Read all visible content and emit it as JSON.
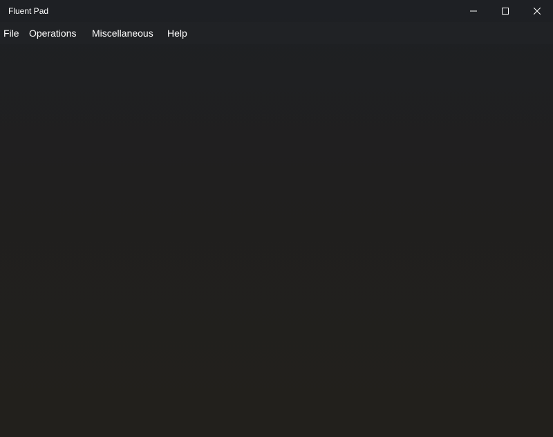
{
  "window": {
    "title": "Fluent Pad",
    "controls": {
      "minimize_icon": "minimize-icon",
      "maximize_icon": "maximize-icon",
      "close_icon": "close-icon"
    }
  },
  "menu": {
    "items": [
      {
        "label": "File"
      },
      {
        "label": "Operations"
      },
      {
        "label": "Miscellaneous"
      },
      {
        "label": "Help"
      }
    ]
  },
  "editor": {
    "text": ""
  },
  "colors": {
    "background": "#202020",
    "text": "#ffffff"
  }
}
